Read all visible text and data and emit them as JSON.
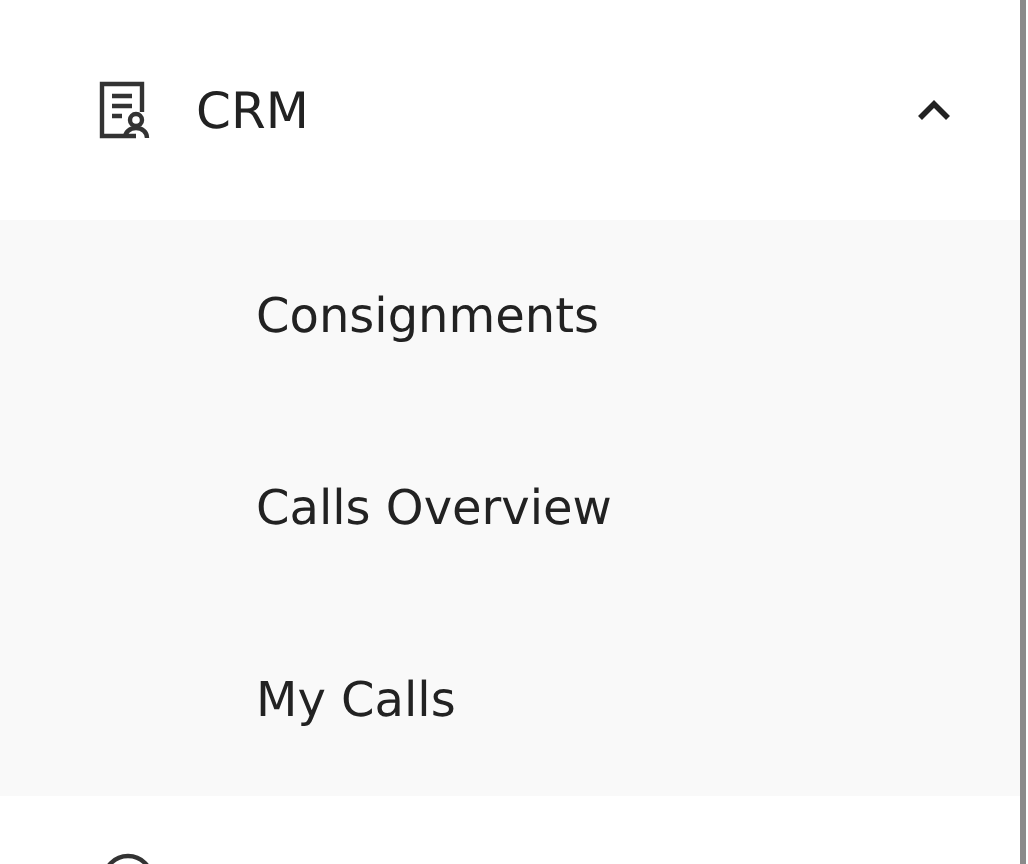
{
  "menu": {
    "label": "CRM",
    "expanded": true,
    "children": [
      {
        "label": "Consignments"
      },
      {
        "label": "Calls Overview"
      },
      {
        "label": "My Calls"
      }
    ]
  }
}
